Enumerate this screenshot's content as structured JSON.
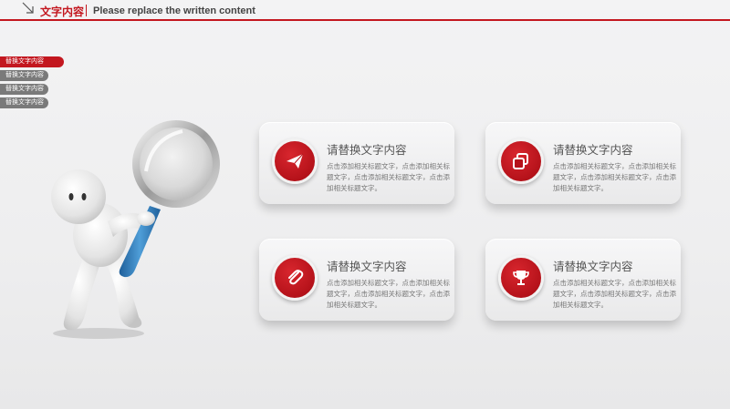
{
  "header": {
    "title": "文字内容",
    "subtitle": "Please replace the written content"
  },
  "nav": {
    "items": [
      {
        "label": "替换文字内容",
        "active": true
      },
      {
        "label": "替换文字内容",
        "active": false
      },
      {
        "label": "替换文字内容",
        "active": false
      },
      {
        "label": "替换文字内容",
        "active": false
      }
    ]
  },
  "cards": [
    {
      "title": "请替换文字内容",
      "icon": "paper-plane-icon",
      "body": "点击添加相关标题文字，点击添加相关标题文字，点击添加相关标题文字，点击添加相关标题文字。"
    },
    {
      "title": "请替换文字内容",
      "icon": "copy-icon",
      "body": "点击添加相关标题文字，点击添加相关标题文字，点击添加相关标题文字，点击添加相关标题文字。"
    },
    {
      "title": "请替换文字内容",
      "icon": "paperclip-icon",
      "body": "点击添加相关标题文字，点击添加相关标题文字，点击添加相关标题文字，点击添加相关标题文字。"
    },
    {
      "title": "请替换文字内容",
      "icon": "trophy-icon",
      "body": "点击添加相关标题文字，点击添加相关标题文字，点击添加相关标题文字，点击添加相关标题文字。"
    }
  ],
  "colors": {
    "accent": "#c3171f",
    "nav_inactive": "#7a7a7a",
    "magnifier_handle": "#2f7fc0"
  }
}
